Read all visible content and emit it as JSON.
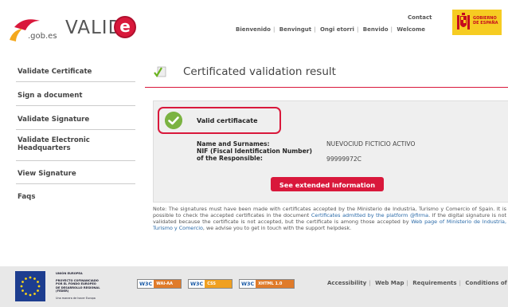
{
  "header": {
    "logo_gob": ".gob.es",
    "logo_valide": "VALID",
    "logo_valide_e": "e",
    "contact": "Contact",
    "languages": [
      "Bienvenido",
      "Benvingut",
      "Ongi etorri",
      "Benvido",
      "Welcome"
    ],
    "gov_line1": "GOBIERNO",
    "gov_line2": "DE ESPAÑA"
  },
  "sidebar": {
    "items": [
      {
        "label": "Validate Certificate"
      },
      {
        "label": "Sign a document"
      },
      {
        "label": "Validate Signature"
      },
      {
        "label": "Validate Electronic Headquarters"
      },
      {
        "label": "View Signature"
      },
      {
        "label": "Faqs"
      }
    ]
  },
  "main": {
    "title": "Certificated validation result",
    "valid_text": "Valid certifiacate",
    "fields": [
      {
        "label": "Name and Surnames:",
        "value": "NUEVOCIUD FICTICIO ACTIVO"
      },
      {
        "label": "NIF (Fiscal Identification Number) of the Responsible:",
        "value": "99999972C"
      }
    ],
    "button": "See extended information",
    "note": {
      "part1": "Note: The signatures must have been made with certificates accepted by the Ministerio de Industria, Turismo y Comercio of Spain. It is possible to check the accepted certificates in the document ",
      "link1": "Certificates admitted by the platform @firma",
      "part2": ". If the digital signature is not validated because the certificate is not accepted, but the certificate is among those accepted by ",
      "link2": "Web page of Ministerio de Industria, Turismo y Comercio",
      "part3": ", we advise you to get in touch with the support helpdesk."
    }
  },
  "footer": {
    "eu_line1": "UNIÓN EUROPEA",
    "eu_line2": "PROYECTO COFINANCIADO POR EL FONDO EUROPEO DE DESARROLLO REGIONAL (FEDER)",
    "eu_line3": "Una manera de hacer Europa",
    "badges": [
      {
        "w3c": "W3C",
        "tag": "WAI-AA"
      },
      {
        "w3c": "W3C",
        "tag": "CSS"
      },
      {
        "w3c": "W3C",
        "tag": "XHTML 1.0"
      }
    ],
    "links": [
      "Accessibility",
      "Web Map",
      "Requirements",
      "Conditions of u"
    ]
  }
}
